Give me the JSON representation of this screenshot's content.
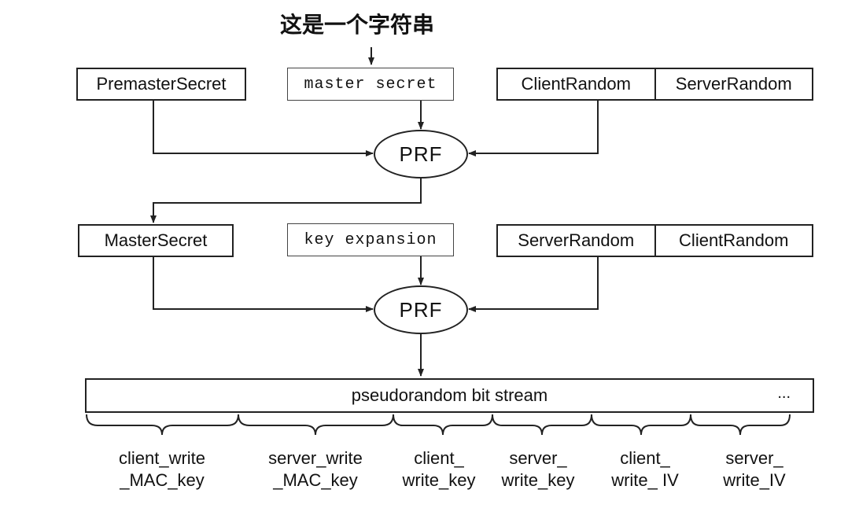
{
  "annotation": {
    "text": "这是一个字符串"
  },
  "row1": {
    "secret_box": "PremasterSecret",
    "label_box": "master secret",
    "pair": [
      "ClientRandom",
      "ServerRandom"
    ]
  },
  "row2": {
    "secret_box": "MasterSecret",
    "label_box": "key expansion",
    "pair": [
      "ServerRandom",
      "ClientRandom"
    ]
  },
  "prf": {
    "top": "PRF",
    "bottom": "PRF"
  },
  "stream": {
    "label": "pseudorandom bit stream",
    "ellipsis": "..."
  },
  "segments": [
    {
      "line1": "client_write",
      "line2": "_MAC_key"
    },
    {
      "line1": "server_write",
      "line2": "_MAC_key"
    },
    {
      "line1": "client_",
      "line2": "write_key"
    },
    {
      "line1": "server_",
      "line2": "write_key"
    },
    {
      "line1": "client_",
      "line2": "write_ IV"
    },
    {
      "line1": "server_",
      "line2": "write_IV"
    }
  ]
}
